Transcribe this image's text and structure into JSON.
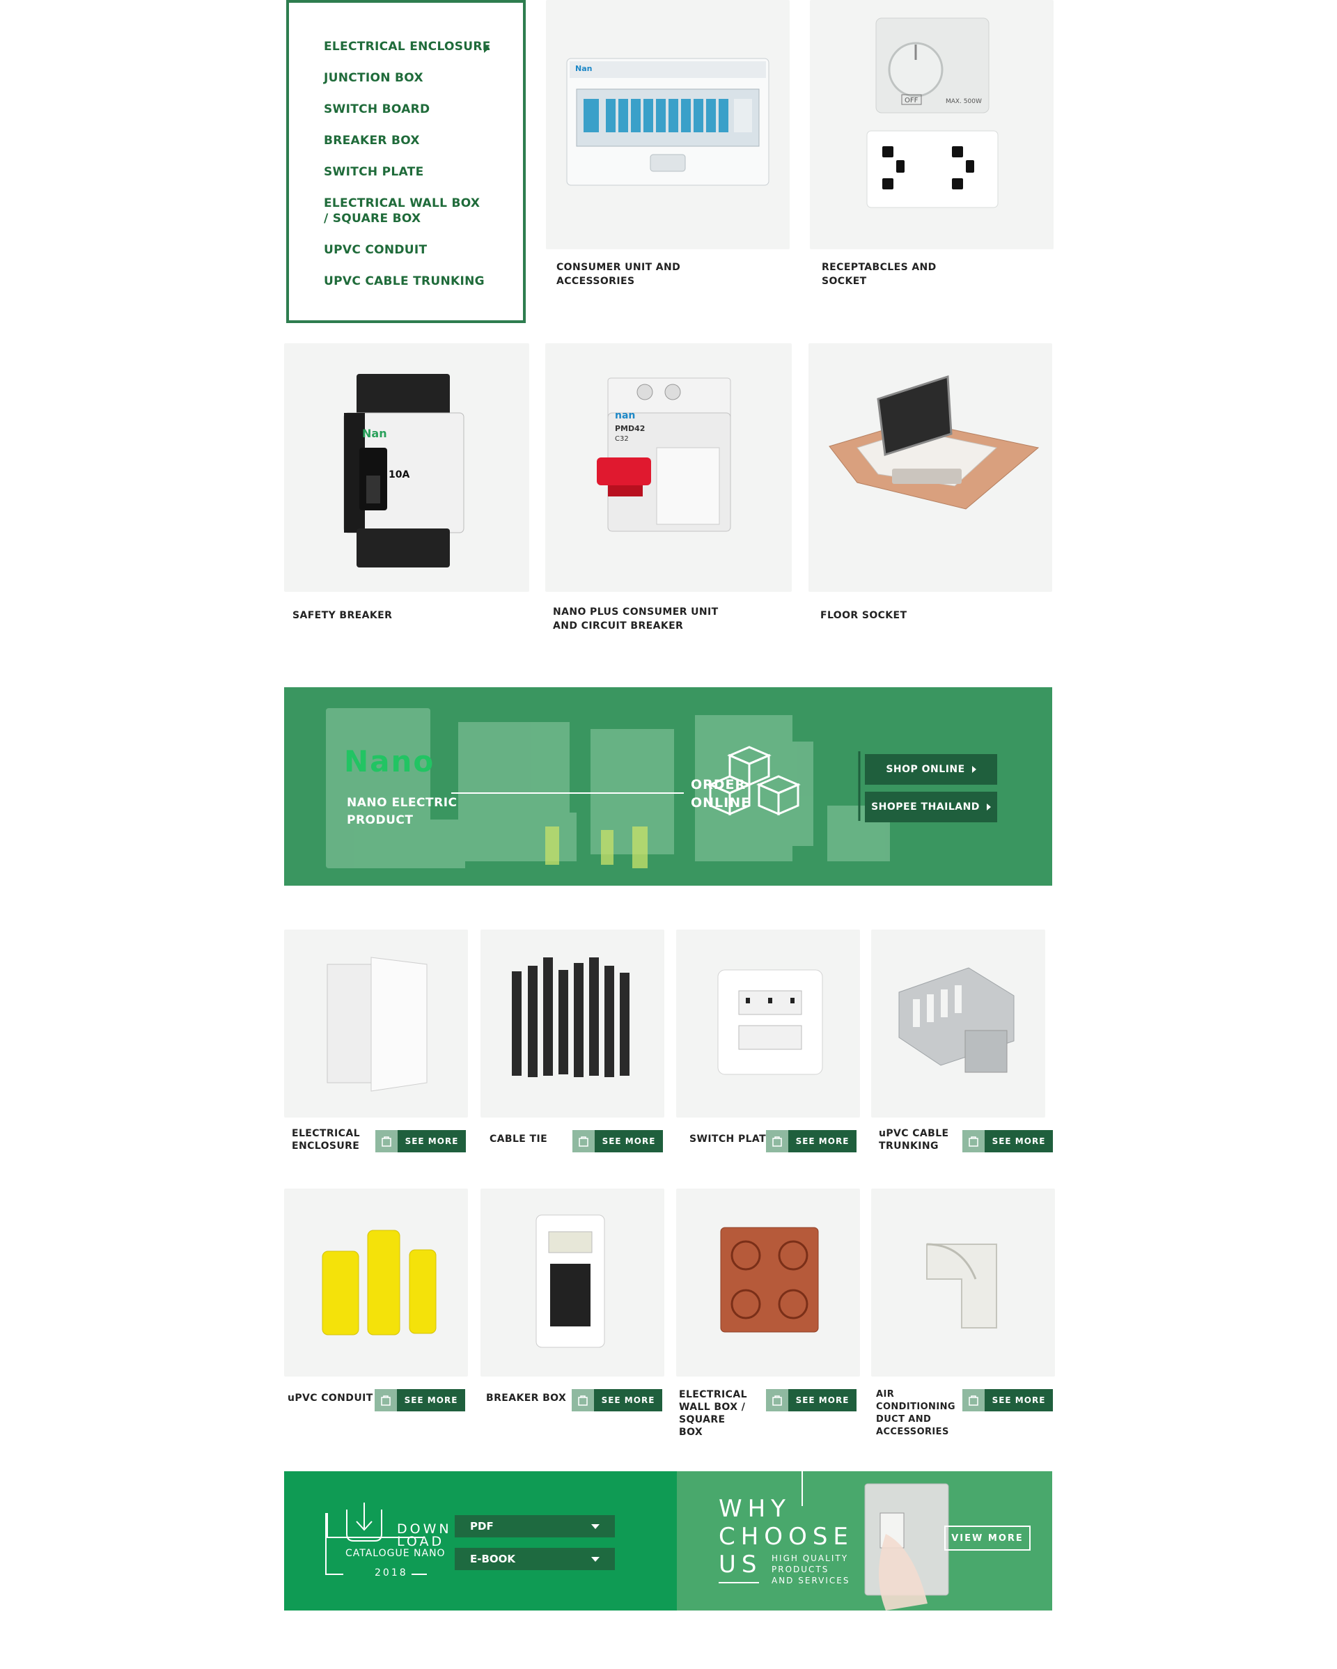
{
  "menu": {
    "items": [
      "ELECTRICAL ENCLOSURE",
      "JUNCTION BOX",
      "SWITCH BOARD",
      "BREAKER BOX",
      "SWITCH PLATE",
      "ELECTRICAL WALL BOX / SQUARE BOX",
      "UPVC CONDUIT",
      "UPVC CABLE TRUNKING"
    ]
  },
  "featured": {
    "consumer_unit": {
      "caption": "CONSUMER UNIT AND ACCESSORIES",
      "brand": "Nan"
    },
    "receptacles": {
      "caption": "RECEPTABCLES AND SOCKET",
      "off_label": "OFF",
      "max_label": "MAX. 500W"
    },
    "safety_breaker": {
      "caption": "SAFETY  BREAKER",
      "brand": "Nan",
      "rating": "10A"
    },
    "nano_plus": {
      "caption": "NANO PLUS CONSUMER UNIT AND CIRCUIT BREAKER",
      "brand": "nan",
      "model": "PMD42",
      "sub": "C32"
    },
    "floor_socket": {
      "caption": "FLOOR  SOCKET"
    }
  },
  "banner": {
    "logo": "Nano",
    "line1": "NANO ELECTRIC",
    "line2": "PRODUCT",
    "order1": "ORDER",
    "order2": "ONLINE",
    "shop_online": "SHOP ONLINE",
    "shopee": "SHOPEE THAILAND"
  },
  "products": {
    "see_more": "SEE MORE",
    "row1": [
      "ELECTRICAL ENCLOSURE",
      "CABLE TIE",
      "SWITCH PLATE",
      "uPVC CABLE TRUNKING"
    ],
    "row2": [
      "uPVC CONDUIT",
      "BREAKER BOX",
      "ELECTRICAL WALL BOX / SQUARE BOX",
      "AIR  CONDITIONING DUCT AND ACCESSORIES"
    ]
  },
  "download": {
    "down": "DOWN",
    "load": "LOAD",
    "catalogue": "CATALOGUE NANO",
    "year": "2018",
    "pdf": "PDF",
    "ebook": "E-BOOK"
  },
  "why": {
    "why": "WHY",
    "choose": "CHOOSE",
    "us": "US",
    "line1": "HIGH QUALITY",
    "line2": "PRODUCTS",
    "line3": "AND SERVICES",
    "view_more": "VIEW MORE"
  },
  "colors": {
    "brand_green": "#2e7d4f",
    "dark_green": "#1f5f3d",
    "banner_green": "#3a9660",
    "download_green": "#0f9b54"
  }
}
